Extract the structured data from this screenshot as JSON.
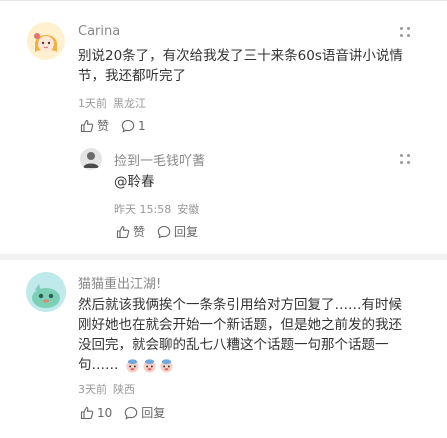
{
  "comments": [
    {
      "author": "Carina",
      "text_line1": "别说20条了，有次给我发了三十来条60s语音讲小说情",
      "text_line2": "节，我还都听完了",
      "time": "1天前",
      "location": "黑龙江",
      "like_label": "赞",
      "comment_count": "1",
      "reply": {
        "author": "捡到一毛钱吖蓍",
        "text": "@聆春",
        "time": "昨天 15:58",
        "location": "安徽",
        "like_label": "赞",
        "reply_label": "回复"
      }
    },
    {
      "author": "猫猫重出江湖!",
      "text_line1": "然后就该我俩挨个一条条引用给对方回复了……有时候",
      "text_line2": "刚好她也在就会开始一个新话题，但是她之前发的我还",
      "text_line3": "没回完，就会聊的乱七八糟这个话题一句那个话题一",
      "text_line4": "句……",
      "time": "3天前",
      "location": "陕西",
      "like_count": "10",
      "reply_label": "回复"
    }
  ],
  "colors": {
    "name": "#888888",
    "meta": "#999999",
    "text": "#333333",
    "divider": "#f1f1f1"
  },
  "icons": [
    "like-icon",
    "comment-icon",
    "reply-icon",
    "more-icon",
    "emoji-icon"
  ]
}
